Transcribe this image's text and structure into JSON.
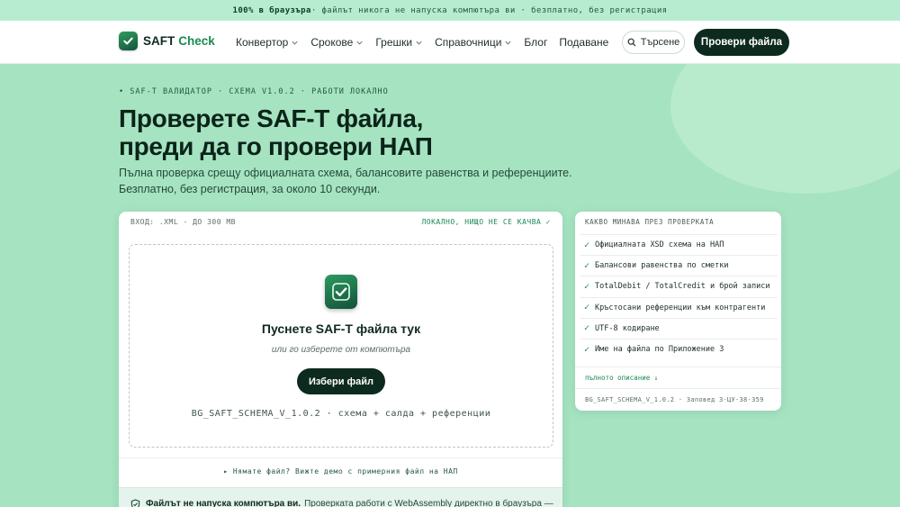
{
  "topbar": {
    "strong": "100% в браузъра",
    "rest": " · файлът никога не напуска компютъра ви · безплатно, без регистрация"
  },
  "header": {
    "logo_main": "SAFT",
    "logo_accent": "Check",
    "nav": [
      {
        "label": "Конвертор",
        "dropdown": true
      },
      {
        "label": "Срокове",
        "dropdown": true
      },
      {
        "label": "Грешки",
        "dropdown": true
      },
      {
        "label": "Справочници",
        "dropdown": true
      },
      {
        "label": "Блог",
        "dropdown": false
      },
      {
        "label": "Подаване",
        "dropdown": false
      }
    ],
    "search_label": "Търсене",
    "cta_label": "Провери файла"
  },
  "hero": {
    "eyebrow": "• SAF-T ВАЛИДАТОР · СХЕМА V1.0.2 · РАБОТИ ЛОКАЛНО",
    "title_line1": "Проверете SAF-T файла,",
    "title_line2": "преди да го провери НАП",
    "subtitle_line1": "Пълна проверка срещу официалната схема, балансовите равенства и референциите.",
    "subtitle_line2": "Безплатно, без регистрация, за около 10 секунди."
  },
  "upload": {
    "meta": "ВХОД: .XML · ДО 300 MB",
    "local": "ЛОКАЛНО, НИЩО НЕ СЕ КАЧВА ✓",
    "drop_title": "Пуснете SAF-T файла тук",
    "drop_sub": "или го изберете от компютъра",
    "choose_label": "Избери файл",
    "schema_line": "BG_SAFT_SCHEMA_V_1.0.2 · схема + салда + референции",
    "demo_link": "▸ Нямате файл? Вижте демо с примерния файл на НАП",
    "notice_bold": "Файлът не напуска компютъра ви.",
    "notice_text": "Проверката работи с WebAssembly директно в браузъра —"
  },
  "checks": {
    "heading": "КАКВО МИНАВА ПРЕЗ ПРОВЕРКАТА",
    "items": [
      "Официалната XSD схема на НАП",
      "Балансови равенства по сметки",
      "TotalDebit / TotalCredit и брой записи",
      "Кръстосани референции към контрагенти",
      "UTF-8 кодиране",
      "Име на файла по Приложение 3"
    ],
    "more_link": "пълното описание ↓",
    "footer": "BG_SAFT_SCHEMA_V_1.0.2 · Заповед З-ЦУ-38-359"
  },
  "colors": {
    "background": "#a6e3c1",
    "brand_green": "#1c8a52",
    "dark_button": "#0d2a1f"
  },
  "icons": {
    "logo": "check-shield-icon",
    "search": "search-icon",
    "chevron": "chevron-down-icon",
    "dropzone": "check-badge-icon",
    "notice": "shield-check-icon"
  }
}
